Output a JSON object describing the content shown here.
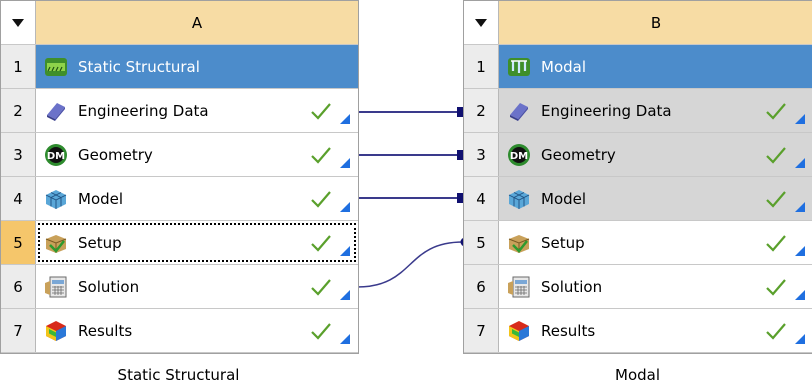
{
  "system_a": {
    "column_letter": "A",
    "rows": [
      {
        "num": "1",
        "label": "Static Structural",
        "icon": "static-structural-icon"
      },
      {
        "num": "2",
        "label": "Engineering Data",
        "icon": "engineering-data-icon"
      },
      {
        "num": "3",
        "label": "Geometry",
        "icon": "geometry-dm-icon",
        "icon_text": "DM"
      },
      {
        "num": "4",
        "label": "Model",
        "icon": "model-mesh-icon"
      },
      {
        "num": "5",
        "label": "Setup",
        "icon": "setup-icon"
      },
      {
        "num": "6",
        "label": "Solution",
        "icon": "solution-icon"
      },
      {
        "num": "7",
        "label": "Results",
        "icon": "results-icon"
      }
    ],
    "caption": "Static Structural"
  },
  "system_b": {
    "column_letter": "B",
    "rows": [
      {
        "num": "1",
        "label": "Modal",
        "icon": "modal-icon"
      },
      {
        "num": "2",
        "label": "Engineering Data",
        "icon": "engineering-data-icon"
      },
      {
        "num": "3",
        "label": "Geometry",
        "icon": "geometry-dm-icon",
        "icon_text": "DM"
      },
      {
        "num": "4",
        "label": "Model",
        "icon": "model-mesh-icon"
      },
      {
        "num": "5",
        "label": "Setup",
        "icon": "setup-icon"
      },
      {
        "num": "6",
        "label": "Solution",
        "icon": "solution-icon"
      },
      {
        "num": "7",
        "label": "Results",
        "icon": "results-icon"
      }
    ],
    "caption": "Modal"
  },
  "colors": {
    "header_bg": "#f7dca4",
    "title_bg": "#4c8ccb",
    "shared_bg": "#d6d6d6",
    "selected_num_bg": "#f5c66b",
    "link_line": "#3a3a8c",
    "check": "#5aa02c",
    "status_triangle": "#1f6fe0"
  }
}
